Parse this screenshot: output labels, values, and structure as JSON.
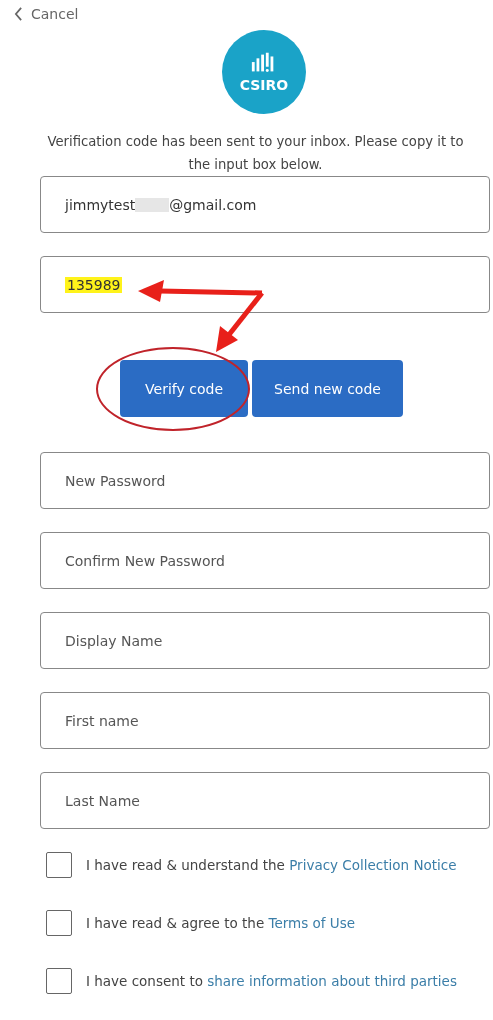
{
  "cancel": {
    "label": "Cancel"
  },
  "logo": {
    "text": "CSIRO"
  },
  "intro": "Verification code has been sent to your inbox. Please copy it to the input box below.",
  "email": {
    "before": "jimmytest",
    "after": "@gmail.com",
    "redacted": true
  },
  "code": {
    "value": "135989",
    "highlighted": true
  },
  "buttons": [
    {
      "label": "Verify code",
      "circled": true
    },
    {
      "label": "Send new code",
      "circled": false
    }
  ],
  "fields": [
    {
      "placeholder": "New Password"
    },
    {
      "placeholder": "Confirm New Password"
    },
    {
      "placeholder": "Display Name"
    },
    {
      "placeholder": "First name"
    },
    {
      "placeholder": "Last Name"
    }
  ],
  "consents": [
    {
      "text": "I have read & understand the ",
      "link": "Privacy Collection Notice",
      "checked": false
    },
    {
      "text": "I have read & agree to the ",
      "link": "Terms of Use",
      "checked": false
    },
    {
      "text": "I have consent to ",
      "link": "share information about third parties",
      "checked": false
    }
  ]
}
